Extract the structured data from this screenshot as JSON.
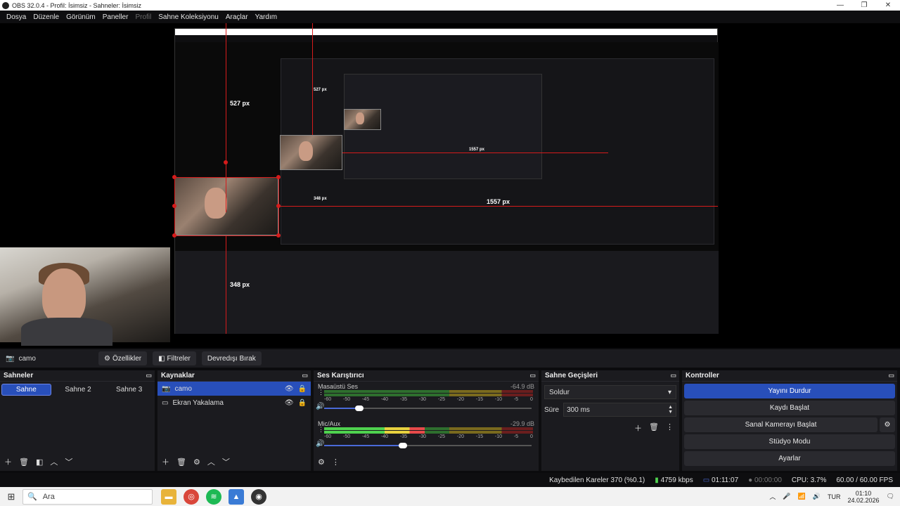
{
  "window": {
    "title": "OBS 32.0.4 - Profil: İsimsiz - Sahneler: İsimsiz",
    "minimize": "—",
    "restore": "❐",
    "close": "✕"
  },
  "menu": [
    {
      "label": "Dosya",
      "enabled": true
    },
    {
      "label": "Düzenle",
      "enabled": true
    },
    {
      "label": "Görünüm",
      "enabled": true
    },
    {
      "label": "Paneller",
      "enabled": true
    },
    {
      "label": "Profil",
      "enabled": false
    },
    {
      "label": "Sahne Koleksiyonu",
      "enabled": true
    },
    {
      "label": "Araçlar",
      "enabled": true
    },
    {
      "label": "Yardım",
      "enabled": true
    }
  ],
  "preview": {
    "measure_top": "527 px",
    "measure_mid": "348 px",
    "measure_right": "1557 px",
    "inner_measure_top": "527 px",
    "inner_measure_mid": "348 px",
    "inner_measure_right": "1557 px"
  },
  "source_bar": {
    "current_source": "camo",
    "properties_label": "Özellikler",
    "filters_label": "Filtreler",
    "disable_label": "Devredışı Bırak"
  },
  "scenes": {
    "title": "Sahneler",
    "items": [
      "Sahne",
      "Sahne 2",
      "Sahne 3"
    ],
    "active": "Sahne"
  },
  "sources": {
    "title": "Kaynaklar",
    "items": [
      {
        "name": "camo",
        "selected": true
      },
      {
        "name": "Ekran Yakalama",
        "selected": false
      }
    ]
  },
  "mixer": {
    "title": "Ses Karıştırıcı",
    "ticks": [
      "-60",
      "-50",
      "-45",
      "-40",
      "-35",
      "-30",
      "-25",
      "-20",
      "-15",
      "-10",
      "-5",
      "0"
    ],
    "channels": [
      {
        "name": "Masaüstü Ses",
        "db": "-64.9 dB",
        "level": 0.0,
        "volume": 0.17
      },
      {
        "name": "Mic/Aux",
        "db": "-29.9 dB",
        "level": 0.48,
        "volume": 0.38
      }
    ]
  },
  "transitions": {
    "title": "Sahne Geçişleri",
    "selected": "Soldur",
    "duration_label": "Süre",
    "duration_value": "300 ms"
  },
  "controls": {
    "title": "Kontroller",
    "stop_stream": "Yayını Durdur",
    "start_record": "Kaydı Başlat",
    "start_virtualcam": "Sanal Kamerayı Başlat",
    "studio_mode": "Stüdyo Modu",
    "settings": "Ayarlar"
  },
  "status": {
    "dropped_frames": "Kaybedilen Kareler 370 (%0.1)",
    "bitrate": "4759 kbps",
    "stream_time": "01:11:07",
    "record_time": "00:00:00",
    "cpu": "CPU: 3.7%",
    "fps": "60.00 / 60.00 FPS"
  },
  "taskbar": {
    "search_placeholder": "Ara",
    "language": "TUR",
    "time": "01:10",
    "date": "24.02.2026"
  },
  "colors": {
    "accent": "#284fba",
    "guide_red": "#d61b1b",
    "panel": "#1b1b1f"
  }
}
